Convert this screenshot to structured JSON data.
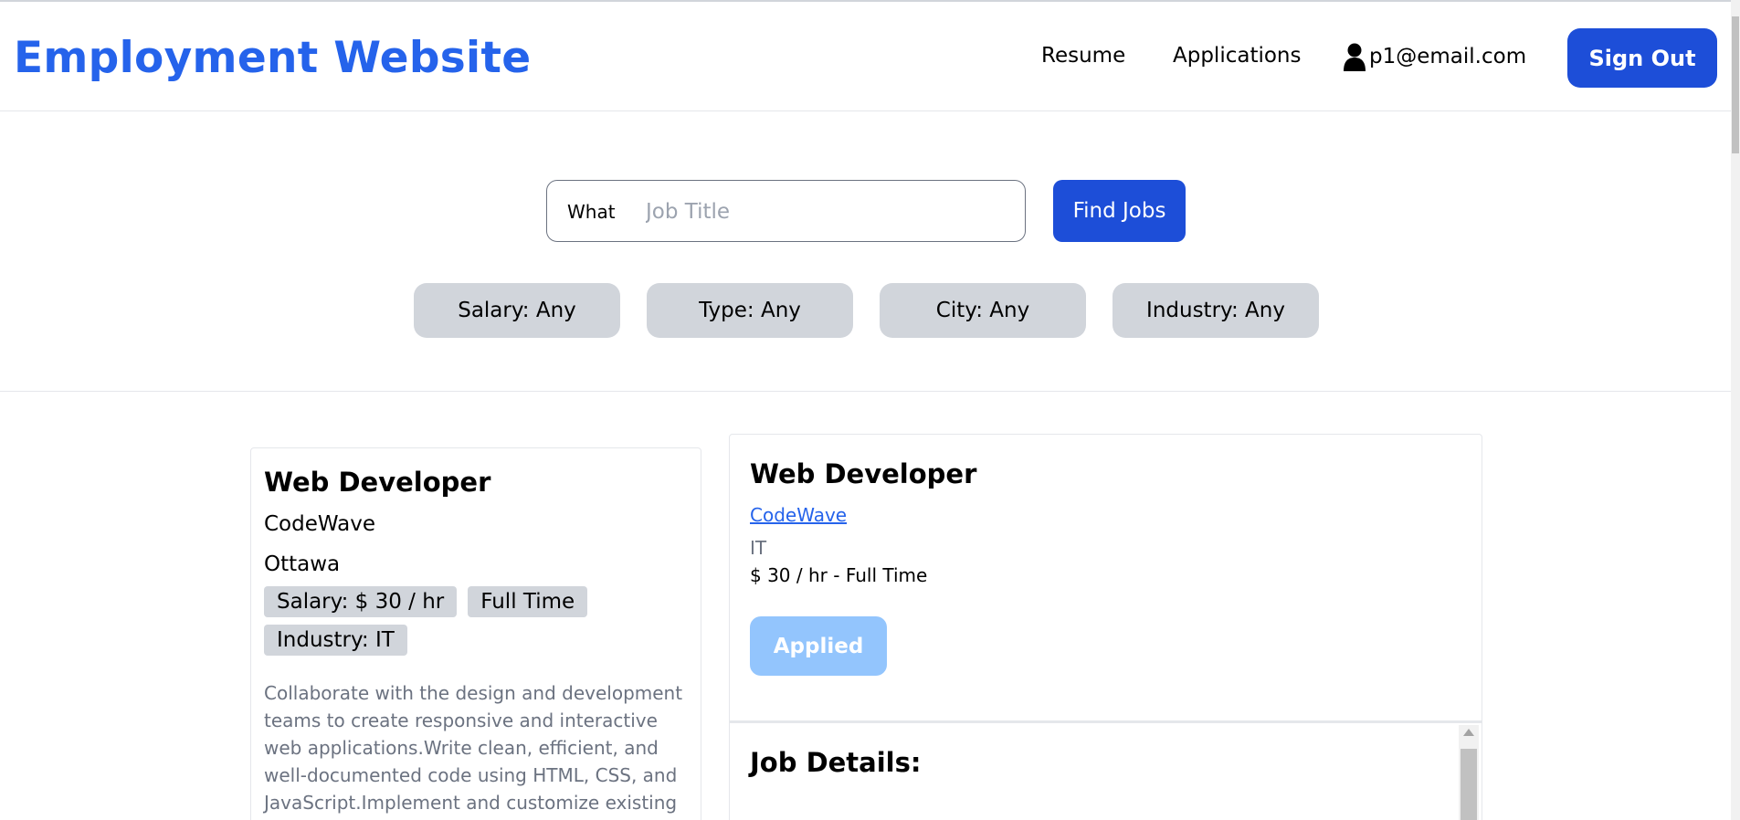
{
  "header": {
    "brand": "Employment Website",
    "nav": {
      "resume": "Resume",
      "applications": "Applications"
    },
    "user_email": "p1@email.com",
    "signout_label": "Sign Out"
  },
  "search": {
    "label": "What",
    "placeholder": "Job Title",
    "button_label": "Find Jobs"
  },
  "filters": [
    "Salary: Any",
    "Type: Any",
    "City: Any",
    "Industry: Any"
  ],
  "job_card": {
    "title": "Web Developer",
    "company": "CodeWave",
    "city": "Ottawa",
    "tags": [
      "Salary: $ 30 / hr",
      "Full Time",
      "Industry: IT"
    ],
    "description": "Collaborate with the design and development teams to create responsive and interactive web applications.Write clean, efficient, and well-documented code using HTML, CSS, and JavaScript.Implement and customize existing web"
  },
  "detail": {
    "title": "Web Developer",
    "company": "CodeWave",
    "industry": "IT",
    "salary_type": "$ 30 / hr - Full Time",
    "applied_label": "Applied",
    "details_heading": "Job Details:"
  },
  "colors": {
    "brand": "#2563eb",
    "primary_button": "#1d4ed8",
    "applied_button": "#93c5fd",
    "chip": "#d1d5db"
  },
  "icons": {
    "user": "user-icon"
  }
}
